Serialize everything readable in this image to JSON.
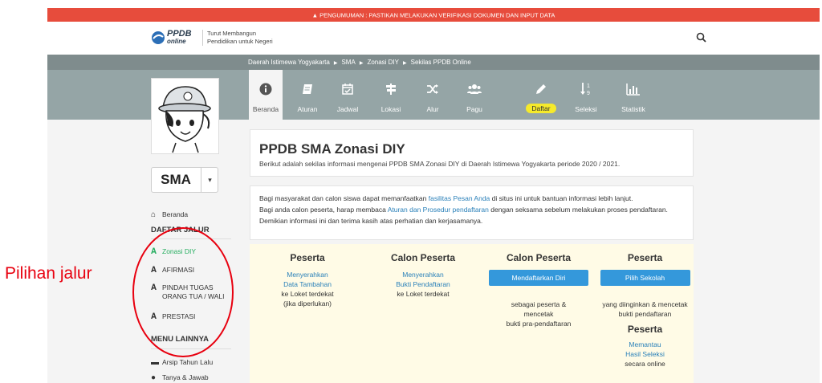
{
  "announcement": {
    "icon": "warning-icon",
    "text": "PENGUMUMAN : PASTIKAN MELAKUKAN VERIFIKASI DOKUMEN DAN INPUT DATA"
  },
  "header": {
    "logo_top": "PPDB",
    "logo_bottom": "online",
    "tagline_line1": "Turut Membangun",
    "tagline_line2": "Pendidikan untuk Negeri",
    "search_icon": "search-icon"
  },
  "breadcrumb": [
    "Daerah Istimewa Yogyakarta",
    "SMA",
    "Zonasi DIY",
    "Sekilas PPDB Online"
  ],
  "nav": [
    {
      "label": "Beranda",
      "icon": "info-icon",
      "glyph": "🛈"
    },
    {
      "label": "Aturan",
      "icon": "book-icon",
      "glyph": "▰"
    },
    {
      "label": "Jadwal",
      "icon": "calendar-check-icon",
      "glyph": "▣"
    },
    {
      "label": "Lokasi",
      "icon": "signpost-icon",
      "glyph": "⊤"
    },
    {
      "label": "Alur",
      "icon": "shuffle-icon",
      "glyph": "⤮"
    },
    {
      "label": "Pagu",
      "icon": "users-icon",
      "glyph": "●"
    },
    {
      "label": "Daftar",
      "icon": "pencil-icon",
      "glyph": "✎"
    },
    {
      "label": "Seleksi",
      "icon": "sort-numeric-icon",
      "glyph": "↓"
    },
    {
      "label": "Statistik",
      "icon": "bar-chart-icon",
      "glyph": "▥"
    }
  ],
  "jenjang": {
    "value": "SMA",
    "caret": "▾"
  },
  "sidebar": {
    "home_label": "Beranda",
    "section_jalur": "DAFTAR JALUR",
    "jalur": [
      {
        "label": "Zonasi DIY",
        "active": true
      },
      {
        "label": "AFIRMASI"
      },
      {
        "label": "PINDAH TUGAS ORANG TUA / WALI"
      },
      {
        "label": "PRESTASI"
      }
    ],
    "section_lain": "MENU LAINNYA",
    "lain": [
      {
        "label": "Arsip Tahun Lalu",
        "icon": "archive-icon"
      },
      {
        "label": "Tanya & Jawab",
        "icon": "chat-icon"
      }
    ]
  },
  "intro": {
    "title": "PPDB SMA Zonasi DIY",
    "subtitle": "Berikut adalah sekilas informasi mengenai PPDB SMA Zonasi DIY di Daerah Istimewa Yogyakarta periode 2020 / 2021."
  },
  "info": {
    "p1_before": "Bagi masyarakat dan calon siswa dapat memanfaatkan ",
    "p1_link": "fasilitas Pesan Anda",
    "p1_after": " di situs ini untuk bantuan informasi lebih lanjut.",
    "p2_before": "Bagi anda calon peserta, harap membaca ",
    "p2_link": "Aturan dan Prosedur pendaftaran",
    "p2_after": " dengan seksama sebelum melakukan proses pendaftaran. Demikian informasi ini dan terima kasih atas perhatian dan kerjasamanya."
  },
  "steps": [
    {
      "title": "Peserta",
      "link1": "Menyerahkan",
      "link2": "Data Tambahan",
      "text1": "ke Loket terdekat",
      "text2": "(jika diperlukan)"
    },
    {
      "title": "Calon Peserta",
      "link1": "Menyerahkan",
      "link2": "Bukti Pendaftaran",
      "text1": "ke Loket terdekat"
    },
    {
      "title": "Calon Peserta",
      "button": "Mendaftarkan Diri",
      "text1": "sebagai peserta &",
      "text2": "mencetak",
      "text3": "bukti pra-pendaftaran"
    },
    {
      "title": "Peserta",
      "button": "Pilih Sekolah",
      "text1": "yang diinginkan & mencetak",
      "text2": "bukti pendaftaran",
      "title2": "Peserta",
      "link1": "Memantau",
      "link2": "Hasil Seleksi",
      "text3": "secara online"
    }
  ],
  "annotation": {
    "text": "Pilihan jalur",
    "color": "#e8000f"
  },
  "colors": {
    "announcement": "#e74c3c",
    "breadcrumb": "#7f8c8d",
    "nav": "#95a5a6",
    "accent": "#3498db",
    "active_jalur": "#27ae60",
    "daftar_highlight": "#f6ea2a"
  }
}
